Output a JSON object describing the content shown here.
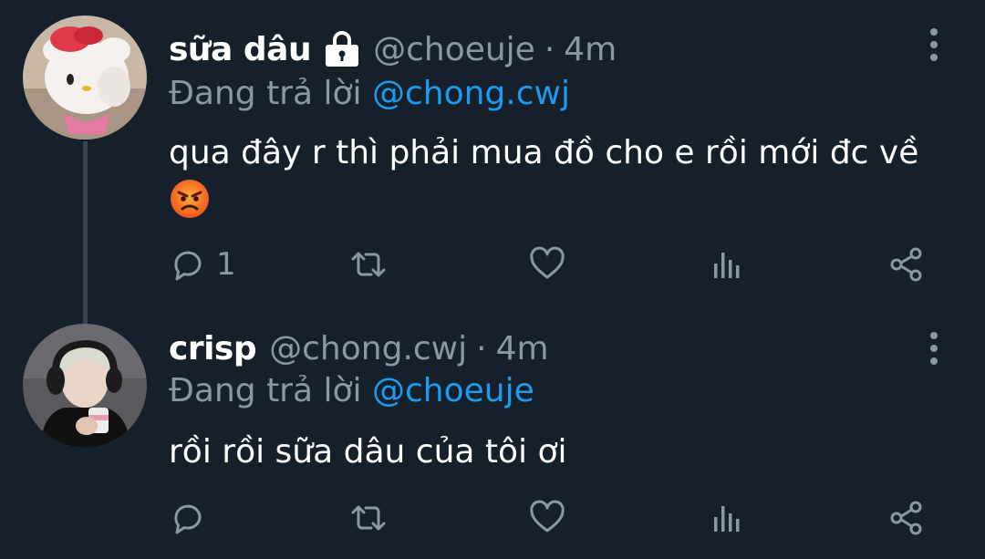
{
  "tweets": [
    {
      "display_name": "sữa dâu",
      "locked": true,
      "handle": "@choeuje",
      "separator": "·",
      "time": "4m",
      "reply_prefix": "Đang trả lời",
      "reply_to": "@chong.cwj",
      "text": "qua đây r thì phải mua đồ cho e rồi mới đc về",
      "emoji": "angry-face",
      "reply_count": "1",
      "avatar": "hello-kitty-plush-avatar"
    },
    {
      "display_name": "crisp",
      "locked": false,
      "handle": "@chong.cwj",
      "separator": "·",
      "time": "4m",
      "reply_prefix": "Đang trả lời",
      "reply_to": "@choeuje",
      "text": "rồi rồi sữa dâu của tôi ơi",
      "reply_count": "",
      "avatar": "person-with-headset-avatar"
    }
  ],
  "icons": {
    "reply": "reply-icon",
    "retweet": "retweet-icon",
    "like": "heart-icon",
    "analytics": "analytics-icon",
    "share": "share-icon",
    "more": "more-vertical-icon",
    "lock": "lock-icon"
  },
  "colors": {
    "background": "#15202b",
    "text_primary": "#ffffff",
    "text_secondary": "#8899a6",
    "link": "#1d9bf0",
    "thread_line": "#38444d"
  }
}
